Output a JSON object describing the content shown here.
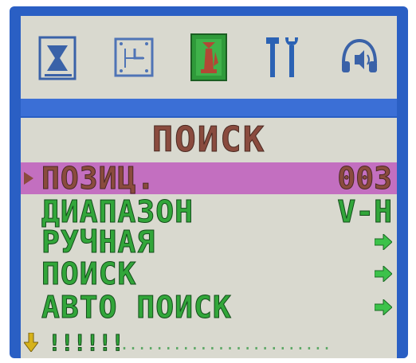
{
  "colors": {
    "frame": "#2a5fc4",
    "panel": "#d9d9cf",
    "selected_row": "#c36fc0",
    "text_green": "#32a63a",
    "text_brown": "#8a4b3e",
    "arrow_green": "#3cc24a",
    "arrow_yellow": "#d6b21a"
  },
  "icon_bar": [
    {
      "name": "picture-icon",
      "selected": false
    },
    {
      "name": "clock-icon",
      "selected": false
    },
    {
      "name": "tuning-icon",
      "selected": true
    },
    {
      "name": "tools-icon",
      "selected": false
    },
    {
      "name": "sound-icon",
      "selected": false
    }
  ],
  "menu": {
    "title": "ПОИСК",
    "rows": [
      {
        "label": "ПОЗИЦ.",
        "value": "003",
        "selected": true
      },
      {
        "label": "ДИАПАЗОН",
        "value": "V-H",
        "selected": false
      },
      {
        "label": "РУЧНАЯ",
        "arrow": "right-arrow-icon",
        "selected": false
      },
      {
        "label": "ПОИСК",
        "arrow": "right-arrow-icon",
        "selected": false
      },
      {
        "label": "АВТО ПОИСК",
        "arrow": "right-arrow-icon",
        "selected": false
      }
    ],
    "bottom": {
      "arrow": "down-arrow-icon",
      "level_marks": "!!!!!!",
      "level_rest": "........................"
    }
  }
}
